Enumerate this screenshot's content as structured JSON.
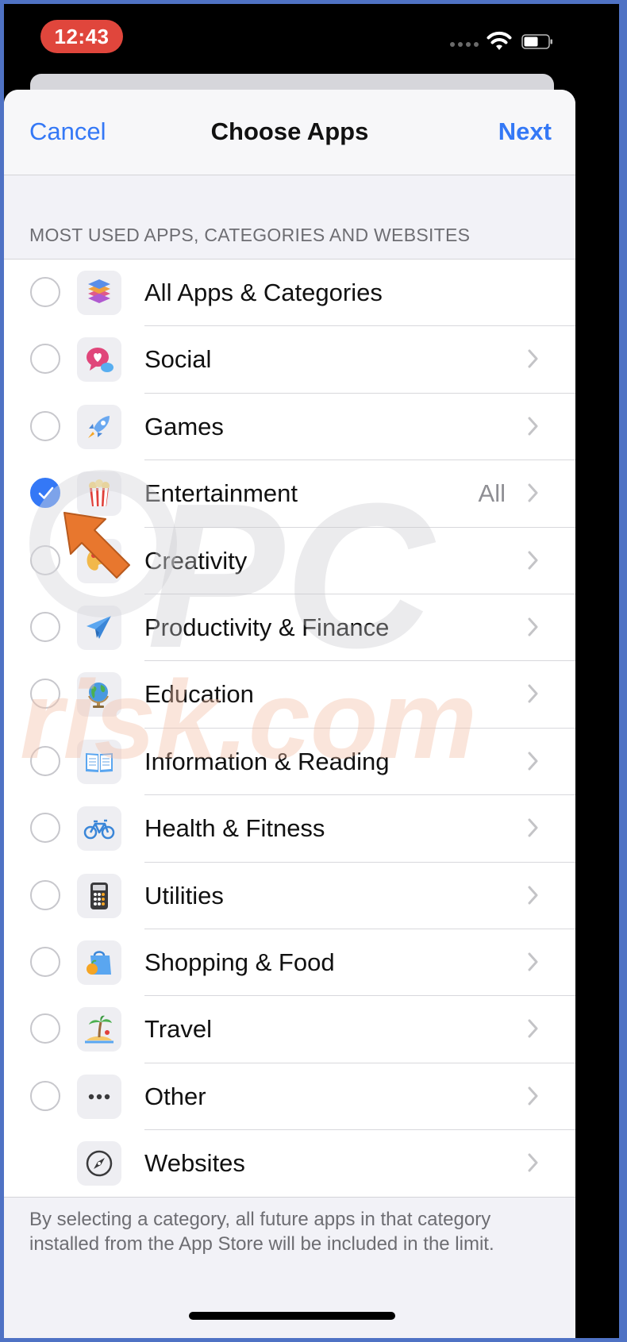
{
  "status_bar": {
    "time": "12:43"
  },
  "nav": {
    "cancel": "Cancel",
    "title": "Choose Apps",
    "next": "Next"
  },
  "section_header": "MOST USED APPS, CATEGORIES AND WEBSITES",
  "categories": [
    {
      "label": "All Apps & Categories",
      "icon": "stack-icon",
      "checked": false,
      "chevron": false,
      "detail": ""
    },
    {
      "label": "Social",
      "icon": "speech-bubble-heart-icon",
      "checked": false,
      "chevron": true,
      "detail": ""
    },
    {
      "label": "Games",
      "icon": "rocket-icon",
      "checked": false,
      "chevron": true,
      "detail": ""
    },
    {
      "label": "Entertainment",
      "icon": "popcorn-icon",
      "checked": true,
      "chevron": true,
      "detail": "All"
    },
    {
      "label": "Creativity",
      "icon": "palette-icon",
      "checked": false,
      "chevron": true,
      "detail": ""
    },
    {
      "label": "Productivity & Finance",
      "icon": "paper-plane-icon",
      "checked": false,
      "chevron": true,
      "detail": ""
    },
    {
      "label": "Education",
      "icon": "globe-icon",
      "checked": false,
      "chevron": true,
      "detail": ""
    },
    {
      "label": "Information & Reading",
      "icon": "open-book-icon",
      "checked": false,
      "chevron": true,
      "detail": ""
    },
    {
      "label": "Health & Fitness",
      "icon": "bicycle-icon",
      "checked": false,
      "chevron": true,
      "detail": ""
    },
    {
      "label": "Utilities",
      "icon": "calculator-icon",
      "checked": false,
      "chevron": true,
      "detail": ""
    },
    {
      "label": "Shopping & Food",
      "icon": "shopping-bag-icon",
      "checked": false,
      "chevron": true,
      "detail": ""
    },
    {
      "label": "Travel",
      "icon": "palm-tree-icon",
      "checked": false,
      "chevron": true,
      "detail": ""
    },
    {
      "label": "Other",
      "icon": "ellipsis-icon",
      "checked": false,
      "chevron": true,
      "detail": ""
    },
    {
      "label": "Websites",
      "icon": "compass-icon",
      "checked": null,
      "chevron": true,
      "detail": ""
    }
  ],
  "footer_text": "By selecting a category, all future apps in that category installed from the App Store will be included in the limit.",
  "watermark": "PC risk.com",
  "colors": {
    "accent": "#3478f6",
    "pointer_arrow": "#e8772e",
    "time_pill": "#e0463c"
  }
}
